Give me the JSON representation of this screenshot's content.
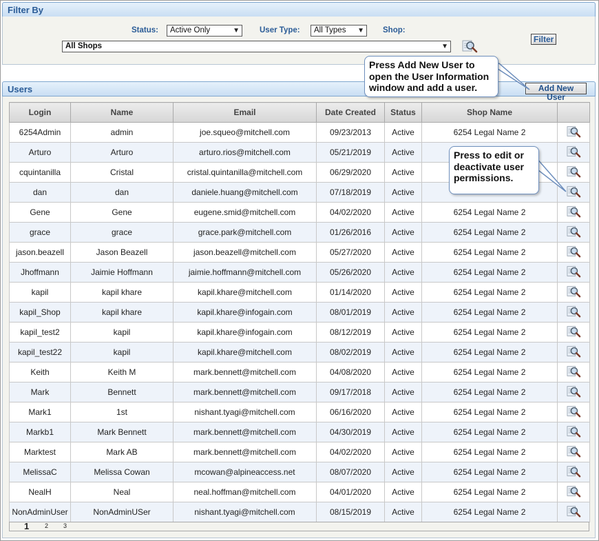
{
  "filter": {
    "title": "Filter By",
    "status_label": "Status:",
    "status_value": "Active Only",
    "user_type_label": "User Type:",
    "user_type_value": "All Types",
    "shop_label": "Shop:",
    "shop_value": "All Shops",
    "filter_button": "Filter",
    "search_icon": "magnifier-icon"
  },
  "users": {
    "title": "Users",
    "add_button": "Add New User",
    "columns": [
      "Login",
      "Name",
      "Email",
      "Date Created",
      "Status",
      "Shop Name",
      ""
    ],
    "rows": [
      {
        "login": "6254Admin",
        "name": "admin",
        "email": "joe.squeo@mitchell.com",
        "date": "09/23/2013",
        "status": "Active",
        "shop": "6254 Legal Name 2"
      },
      {
        "login": "Arturo",
        "name": "Arturo",
        "email": "arturo.rios@mitchell.com",
        "date": "05/21/2019",
        "status": "Active",
        "shop": ""
      },
      {
        "login": "cquintanilla",
        "name": "Cristal",
        "email": "cristal.quintanilla@mitchell.com",
        "date": "06/29/2020",
        "status": "Active",
        "shop": ""
      },
      {
        "login": "dan",
        "name": "dan",
        "email": "daniele.huang@mitchell.com",
        "date": "07/18/2019",
        "status": "Active",
        "shop": ""
      },
      {
        "login": "Gene",
        "name": "Gene",
        "email": "eugene.smid@mitchell.com",
        "date": "04/02/2020",
        "status": "Active",
        "shop": "6254 Legal Name 2"
      },
      {
        "login": "grace",
        "name": "grace",
        "email": "grace.park@mitchell.com",
        "date": "01/26/2016",
        "status": "Active",
        "shop": "6254 Legal Name 2"
      },
      {
        "login": "jason.beazell",
        "name": "Jason Beazell",
        "email": "jason.beazell@mitchell.com",
        "date": "05/27/2020",
        "status": "Active",
        "shop": "6254 Legal Name 2"
      },
      {
        "login": "Jhoffmann",
        "name": "Jaimie Hoffmann",
        "email": "jaimie.hoffmann@mitchell.com",
        "date": "05/26/2020",
        "status": "Active",
        "shop": "6254 Legal Name 2"
      },
      {
        "login": "kapil",
        "name": "kapil khare",
        "email": "kapil.khare@mitchell.com",
        "date": "01/14/2020",
        "status": "Active",
        "shop": "6254 Legal Name 2"
      },
      {
        "login": "kapil_Shop",
        "name": "kapil khare",
        "email": "kapil.khare@infogain.com",
        "date": "08/01/2019",
        "status": "Active",
        "shop": "6254 Legal Name 2"
      },
      {
        "login": "kapil_test2",
        "name": "kapil",
        "email": "kapil.khare@infogain.com",
        "date": "08/12/2019",
        "status": "Active",
        "shop": "6254 Legal Name 2"
      },
      {
        "login": "kapil_test22",
        "name": "kapil",
        "email": "kapil.khare@mitchell.com",
        "date": "08/02/2019",
        "status": "Active",
        "shop": "6254 Legal Name 2"
      },
      {
        "login": "Keith",
        "name": "Keith M",
        "email": "mark.bennett@mitchell.com",
        "date": "04/08/2020",
        "status": "Active",
        "shop": "6254 Legal Name 2"
      },
      {
        "login": "Mark",
        "name": "Bennett",
        "email": "mark.bennett@mitchell.com",
        "date": "09/17/2018",
        "status": "Active",
        "shop": "6254 Legal Name 2"
      },
      {
        "login": "Mark1",
        "name": "1st",
        "email": "nishant.tyagi@mitchell.com",
        "date": "06/16/2020",
        "status": "Active",
        "shop": "6254 Legal Name 2"
      },
      {
        "login": "Markb1",
        "name": "Mark Bennett",
        "email": "mark.bennett@mitchell.com",
        "date": "04/30/2019",
        "status": "Active",
        "shop": "6254 Legal Name 2"
      },
      {
        "login": "Marktest",
        "name": "Mark AB",
        "email": "mark.bennett@mitchell.com",
        "date": "04/02/2020",
        "status": "Active",
        "shop": "6254 Legal Name 2"
      },
      {
        "login": "MelissaC",
        "name": "Melissa Cowan",
        "email": "mcowan@alpineaccess.net",
        "date": "08/07/2020",
        "status": "Active",
        "shop": "6254 Legal Name 2"
      },
      {
        "login": "NealH",
        "name": "Neal",
        "email": "neal.hoffman@mitchell.com",
        "date": "04/01/2020",
        "status": "Active",
        "shop": "6254 Legal Name 2"
      },
      {
        "login": "NonAdminUser",
        "name": "NonAdminUSer",
        "email": "nishant.tyagi@mitchell.com",
        "date": "08/15/2019",
        "status": "Active",
        "shop": "6254 Legal Name 2"
      }
    ],
    "edit_icon": "magnifier-edit-icon",
    "pages": [
      "1",
      "2",
      "3"
    ]
  },
  "callouts": {
    "add_user": "Press Add New User to open the User Information window and add a user.",
    "edit_user": "Press to edit or deactivate user permissions."
  },
  "colors": {
    "header_text": "#2b5c97",
    "alt_row": "#eef3fa",
    "callout_border": "#6e8fbd"
  }
}
